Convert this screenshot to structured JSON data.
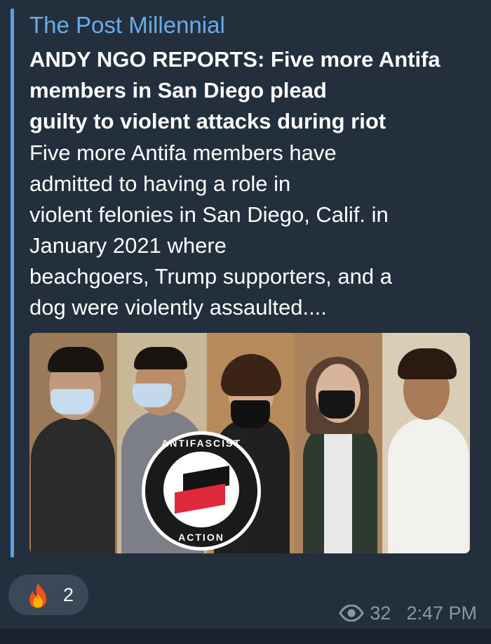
{
  "message": {
    "site_name": "The Post Millennial",
    "title": "ANDY NGO REPORTS: Five more Antifa\nmembers in San Diego plead\nguilty to violent attacks during riot",
    "description": "Five more Antifa members have\nadmitted to having a role in\nviolent felonies in San Diego, Calif. in\nJanuary 2021 where\nbeachgoers, Trump supporters, and a\ndog were violently assaulted....",
    "image": {
      "logo_text_top": "ANTIFASCIST",
      "logo_text_bottom": "ACTION"
    }
  },
  "reaction": {
    "emoji_icon": "fire-icon",
    "count": "2"
  },
  "meta": {
    "views_icon": "eye-icon",
    "views": "32",
    "time": "2:47 PM"
  },
  "colors": {
    "bubble_bg": "#242f3d",
    "accent": "#5ba0e0",
    "site_name": "#68adea",
    "meta_text": "#8a97a6",
    "reaction_bg": "#3a4858"
  }
}
